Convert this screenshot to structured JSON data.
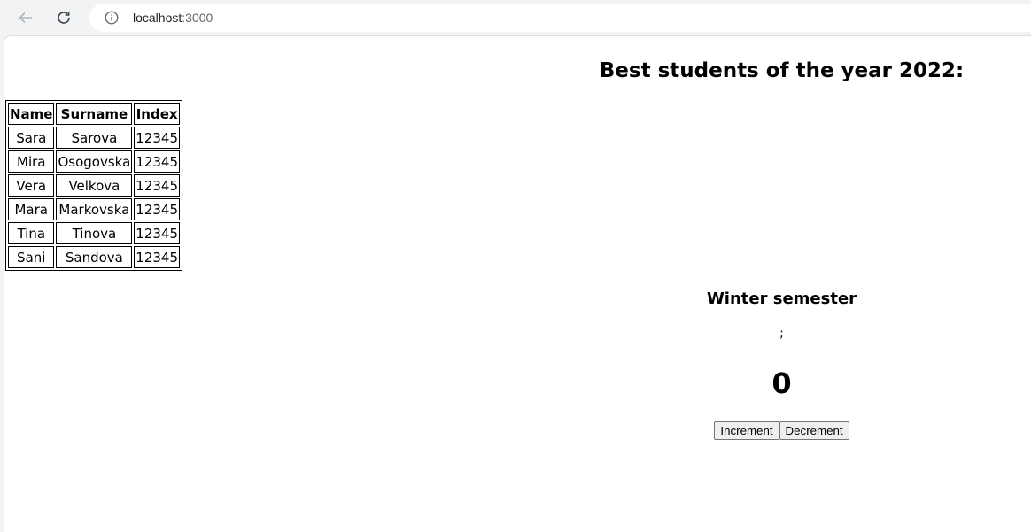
{
  "browser": {
    "url_host": "localhost",
    "url_port": ":3000"
  },
  "page": {
    "title": "Best students of the year 2022:",
    "table": {
      "headers": [
        "Name",
        "Surname",
        "Index"
      ],
      "rows": [
        [
          "Sara",
          "Sarova",
          "12345"
        ],
        [
          "Mira",
          "Osogovska",
          "12345"
        ],
        [
          "Vera",
          "Velkova",
          "12345"
        ],
        [
          "Mara",
          "Markovska",
          "12345"
        ],
        [
          "Tina",
          "Tinova",
          "12345"
        ],
        [
          "Sani",
          "Sandova",
          "12345"
        ]
      ]
    },
    "semester_title": "Winter semester",
    "separator_text": ";",
    "counter_value": "0",
    "increment_label": "Increment",
    "decrement_label": "Decrement"
  }
}
